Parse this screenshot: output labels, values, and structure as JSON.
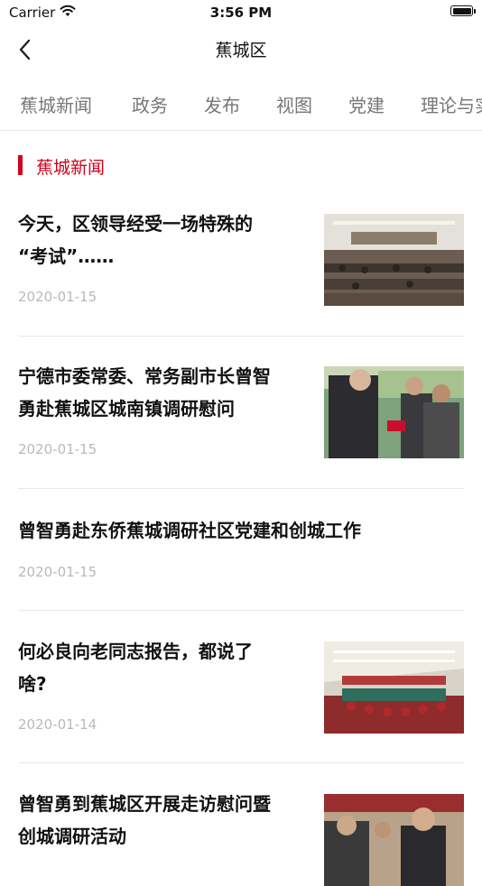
{
  "status": {
    "carrier": "Carrier",
    "time": "3:56 PM"
  },
  "nav": {
    "title": "蕉城区"
  },
  "tabs": [
    {
      "label": "蕉城新闻"
    },
    {
      "label": "政务"
    },
    {
      "label": "发布"
    },
    {
      "label": "视图"
    },
    {
      "label": "党建"
    },
    {
      "label": "理论与实"
    }
  ],
  "section": {
    "title": "蕉城新闻"
  },
  "news": [
    {
      "title_line1": "今天，区领导经受一场特殊的",
      "title_line2": "“考试”……",
      "date": "2020-01-15",
      "image": "meeting-hall-photo"
    },
    {
      "title_line1": "宁德市委常委、常务副市长曾智",
      "title_line2": "勇赴蕉城区城南镇调研慰问",
      "date": "2020-01-15",
      "image": "greeting-residents-photo"
    },
    {
      "title_line1": "曾智勇赴东侨蕉城调研社区党建和创城工作",
      "title_line2": "",
      "date": "2020-01-15",
      "image": ""
    },
    {
      "title_line1": "何必良向老同志报告，都说了",
      "title_line2": "啥?",
      "date": "2020-01-14",
      "image": "conference-room-photo"
    },
    {
      "title_line1": "曾智勇到蕉城区开展走访慰问暨",
      "title_line2": "创城调研活动",
      "date": "",
      "image": "visit-crowd-photo"
    }
  ],
  "colors": {
    "accent": "#d0021b",
    "tab_text": "#777777",
    "date_text": "#b9b9b9"
  }
}
